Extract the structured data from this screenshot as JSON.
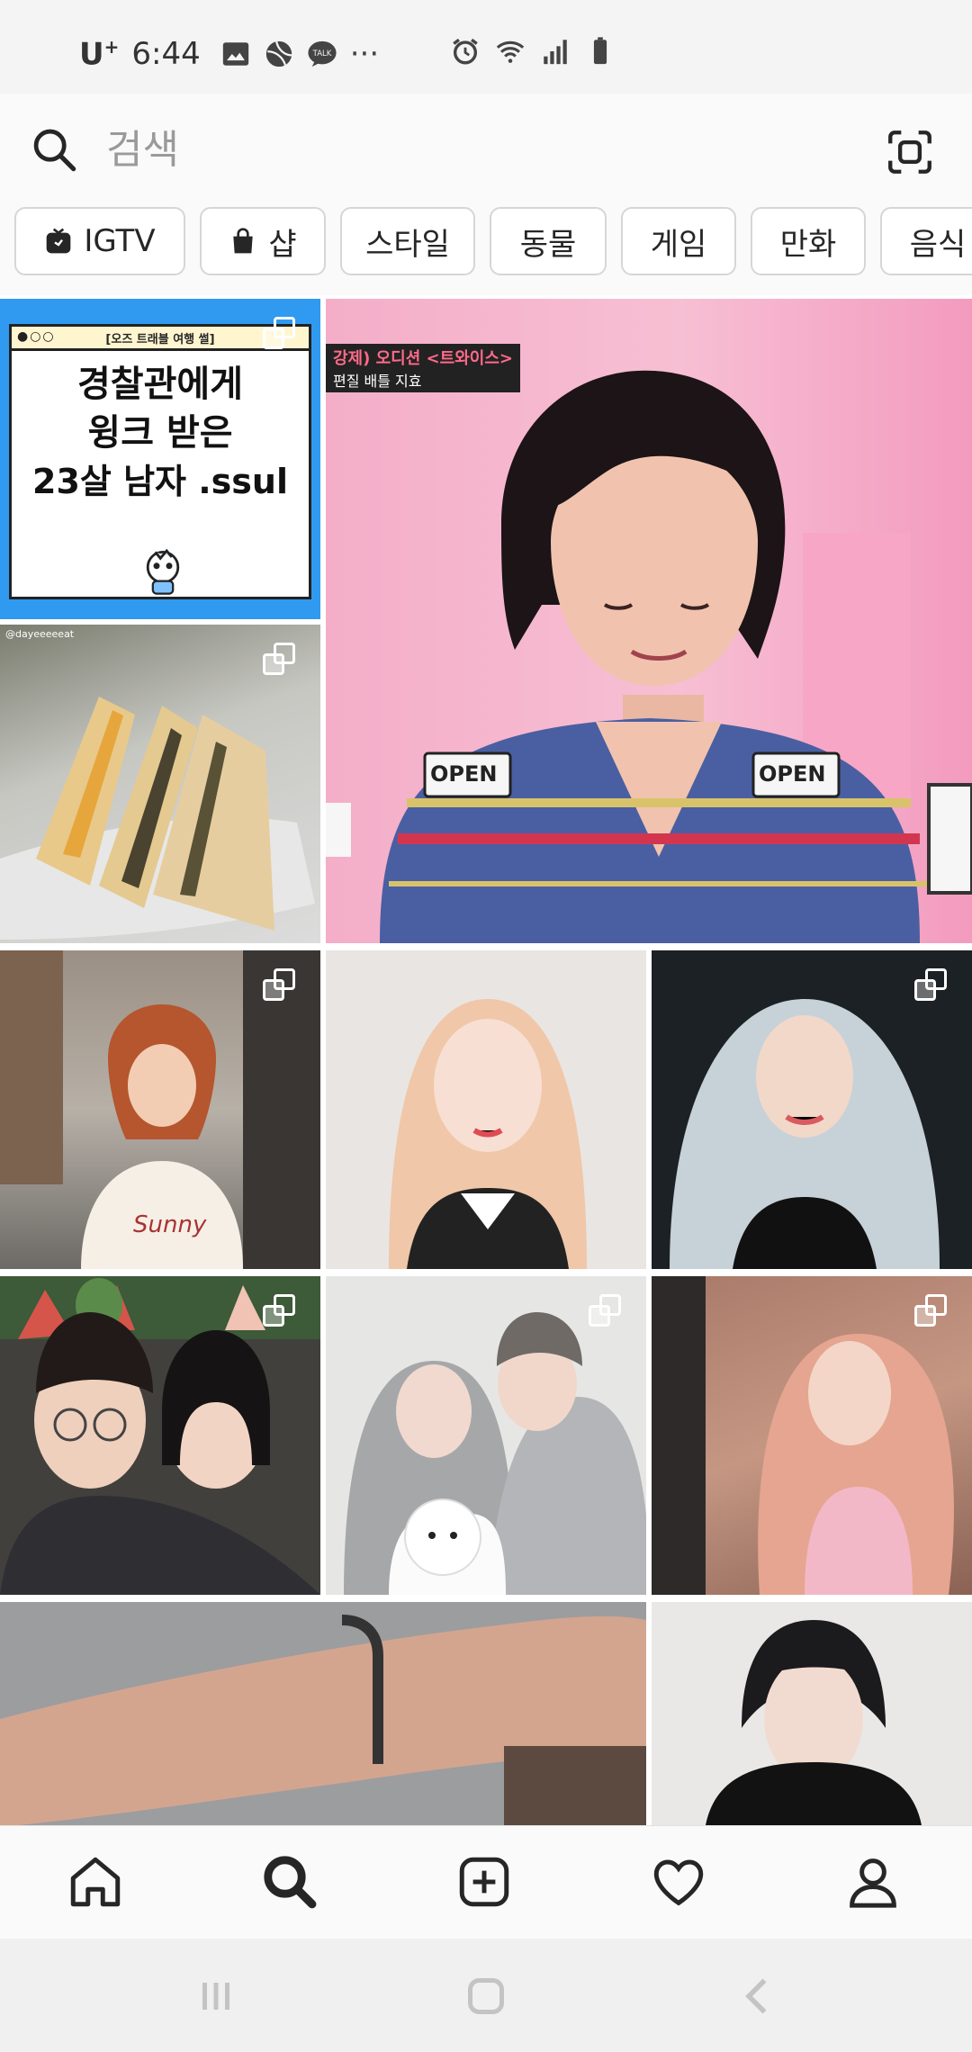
{
  "status_bar": {
    "carrier": "U",
    "carrier_sup": "+",
    "time": "6:44",
    "dots": "···"
  },
  "search": {
    "placeholder": "검색"
  },
  "chips": [
    {
      "label": "IGTV",
      "icon": "igtv-icon"
    },
    {
      "label": "샵",
      "icon": "shop-bag-icon"
    },
    {
      "label": "스타일"
    },
    {
      "label": "동물"
    },
    {
      "label": "게임"
    },
    {
      "label": "만화"
    },
    {
      "label": "음식"
    }
  ],
  "posts": {
    "post1": {
      "banner": "[오즈 트래블 여행 썰]",
      "line1": "경찰관에게",
      "line2": "윙크 받은",
      "line3": "23살 남자 .ssul"
    },
    "post2": {
      "banner": "강제) 오디션 <트와이스>",
      "sub": "편질 배틀 지효",
      "open1": "OPEN",
      "open2": "OPEN"
    },
    "post3": {
      "watermark": "@dayeeeeeat"
    },
    "post4": {
      "shirt": "Sunny"
    }
  },
  "colors": {
    "accent_blue": "#3897f0",
    "header_bg": "#fafafa",
    "text": "#262626"
  }
}
